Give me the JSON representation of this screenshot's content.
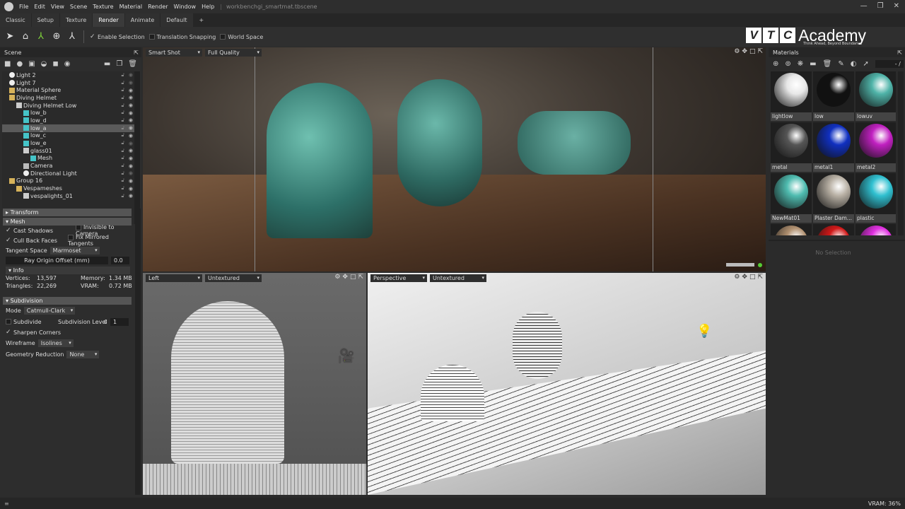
{
  "menubar": {
    "items": [
      "File",
      "Edit",
      "View",
      "Scene",
      "Texture",
      "Material",
      "Render",
      "Window",
      "Help"
    ],
    "document_title": "workbenchgi_smartmat.tbscene"
  },
  "tabs": [
    "Classic",
    "Setup",
    "Texture",
    "Render",
    "Animate",
    "Default",
    "+"
  ],
  "active_tab": "Render",
  "toolbar": {
    "enable_selection": "Enable Selection",
    "translation_snapping": "Translation Snapping",
    "world_space": "World Space",
    "enable_selection_checked": true,
    "translation_snapping_checked": false,
    "world_space_checked": false
  },
  "logo": {
    "brand": "VTC",
    "name": "Academy",
    "tagline": "Think Ahead, Beyond Boundaries"
  },
  "scene": {
    "title": "Scene",
    "tree": [
      {
        "label": "Light 2",
        "type": "light",
        "depth": 1,
        "visible": false
      },
      {
        "label": "Light 7",
        "type": "light",
        "depth": 1,
        "visible": false
      },
      {
        "label": "Material Sphere",
        "type": "folder",
        "depth": 1,
        "visible": true
      },
      {
        "label": "Diving Helmet",
        "type": "folder",
        "depth": 1,
        "visible": true
      },
      {
        "label": "Diving Helmet Low",
        "type": "obj",
        "depth": 2,
        "visible": true
      },
      {
        "label": "low_b",
        "type": "mesh",
        "depth": 3,
        "visible": true
      },
      {
        "label": "low_d",
        "type": "mesh",
        "depth": 3,
        "visible": true
      },
      {
        "label": "low_a",
        "type": "mesh",
        "depth": 3,
        "visible": true,
        "selected": true
      },
      {
        "label": "low_c",
        "type": "mesh",
        "depth": 3,
        "visible": true
      },
      {
        "label": "low_e",
        "type": "mesh",
        "depth": 3,
        "visible": false
      },
      {
        "label": "glass01",
        "type": "obj",
        "depth": 3,
        "visible": true
      },
      {
        "label": "Mesh",
        "type": "mesh",
        "depth": 4,
        "visible": true
      },
      {
        "label": "Camera",
        "type": "cam",
        "depth": 3,
        "visible": true
      },
      {
        "label": "Directional Light",
        "type": "light",
        "depth": 3,
        "visible": false
      },
      {
        "label": "Group 16",
        "type": "folder",
        "depth": 1,
        "visible": true
      },
      {
        "label": "Vespameshes",
        "type": "folder",
        "depth": 2,
        "visible": true
      },
      {
        "label": "vespalights_01",
        "type": "obj",
        "depth": 3,
        "visible": true
      }
    ]
  },
  "properties": {
    "transform": "Transform",
    "mesh": {
      "title": "Mesh",
      "cast_shadows": "Cast Shadows",
      "invisible_to_camera": "Invisible to Camera",
      "cull_back_faces": "Cull Back Faces",
      "fix_mirrored_tangents": "Fix Mirrored Tangents",
      "tangent_space_label": "Tangent Space",
      "tangent_space_value": "Marmoset",
      "ray_origin_label": "Ray Origin Offset (mm)",
      "ray_origin_value": "0.0"
    },
    "info": {
      "title": "Info",
      "vertices_label": "Vertices:",
      "vertices": "13,597",
      "triangles_label": "Triangles:",
      "triangles": "22,269",
      "memory_label": "Memory:",
      "memory": "1.34 MB",
      "vram_label": "VRAM:",
      "vram": "0.72 MB"
    },
    "subdivision": {
      "title": "Subdivision",
      "mode_label": "Mode",
      "mode_value": "Catmull-Clark",
      "subdivide": "Subdivide",
      "level_label": "Subdivision Level",
      "level_value": "1",
      "sharpen": "Sharpen Corners",
      "wireframe_label": "Wireframe",
      "wireframe_value": "Isolines",
      "reduction_label": "Geometry Reduction",
      "reduction_value": "None"
    }
  },
  "viewports": {
    "main": {
      "camera": "Smart Shot",
      "quality": "Full Quality"
    },
    "left": {
      "camera": "Left",
      "shading": "Untextured"
    },
    "perspective": {
      "camera": "Perspective",
      "shading": "Untextured"
    }
  },
  "materials": {
    "title": "Materials",
    "page": "- /",
    "no_selection": "No Selection",
    "items": [
      {
        "name": "lightlow",
        "color": "#e8e8e8"
      },
      {
        "name": "low",
        "color": "#111111"
      },
      {
        "name": "lowuv",
        "color": "#4fb3a8"
      },
      {
        "name": "metal",
        "color": "#555555"
      },
      {
        "name": "metal1",
        "color": "#1030c0"
      },
      {
        "name": "metal2",
        "color": "#c020c0"
      },
      {
        "name": "NewMat01",
        "color": "#4fbcb0"
      },
      {
        "name": "Plaster Dam...",
        "color": "#b8b0a4"
      },
      {
        "name": "plastic",
        "color": "#30c0d0"
      },
      {
        "name": "",
        "color": "#b09070"
      },
      {
        "name": "",
        "color": "#d01818"
      },
      {
        "name": "",
        "color": "#e030e0"
      }
    ]
  },
  "status": {
    "vram": "VRAM: 36%"
  }
}
